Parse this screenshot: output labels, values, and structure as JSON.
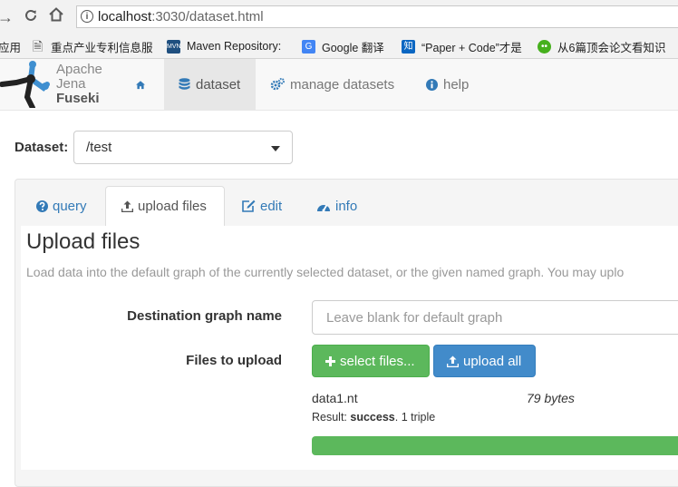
{
  "browser": {
    "url_host": "localhost",
    "url_path": ":3030/dataset.html"
  },
  "bookmarks": [
    {
      "label": "应用",
      "icon": "apps-icon"
    },
    {
      "label": "重点产业专利信息服",
      "icon": "page-icon"
    },
    {
      "label": "Maven Repository:",
      "icon": "mvn-icon"
    },
    {
      "label": "Google 翻译",
      "icon": "google-translate-icon"
    },
    {
      "label": "“Paper + Code”才是",
      "icon": "zhihu-icon"
    },
    {
      "label": "从6篇顶会论文看知识",
      "icon": "wechat-icon"
    }
  ],
  "logo": {
    "line1": "Apache",
    "line2": "Jena",
    "line3": "Fuseki"
  },
  "nav": {
    "home_icon": "home-icon",
    "dataset": "dataset",
    "manage": "manage datasets",
    "help": "help"
  },
  "dataset": {
    "label": "Dataset:",
    "selected": "/test"
  },
  "tabs": {
    "query": "query",
    "upload": "upload files",
    "edit": "edit",
    "info": "info"
  },
  "upload": {
    "title": "Upload files",
    "description": "Load data into the default graph of the currently selected dataset, or the given named graph. You may uplo",
    "dest_label": "Destination graph name",
    "dest_placeholder": "Leave blank for default graph",
    "files_label": "Files to upload",
    "select_button": "select files...",
    "upload_all_button": "upload all",
    "file": {
      "name": "data1.nt",
      "size": "79 bytes",
      "result_prefix": "Result:",
      "result_status": "success",
      "result_detail": ". 1 triple",
      "progress": 1.0
    }
  },
  "colors": {
    "green": "#5cb85c",
    "blue": "#428bca",
    "link": "#337ab7"
  }
}
